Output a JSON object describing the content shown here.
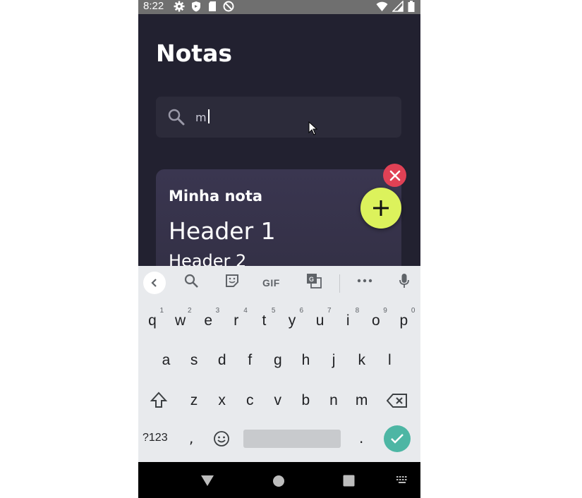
{
  "status_bar": {
    "time": "8:22"
  },
  "app": {
    "title": "Notas",
    "search": {
      "value": "m",
      "placeholder": ""
    },
    "note": {
      "title": "Minha nota",
      "header1": "Header 1",
      "header2": "Header 2"
    }
  },
  "keyboard": {
    "gif_label": "GIF",
    "row1": [
      {
        "key": "q",
        "hint": "1"
      },
      {
        "key": "w",
        "hint": "2"
      },
      {
        "key": "e",
        "hint": "3"
      },
      {
        "key": "r",
        "hint": "4"
      },
      {
        "key": "t",
        "hint": "5"
      },
      {
        "key": "y",
        "hint": "6"
      },
      {
        "key": "u",
        "hint": "7"
      },
      {
        "key": "i",
        "hint": "8"
      },
      {
        "key": "o",
        "hint": "9"
      },
      {
        "key": "p",
        "hint": "0"
      }
    ],
    "row2": [
      "a",
      "s",
      "d",
      "f",
      "g",
      "h",
      "j",
      "k",
      "l"
    ],
    "row3": [
      "z",
      "x",
      "c",
      "v",
      "b",
      "n",
      "m"
    ],
    "symbols_key": "?123",
    "comma_key": ",",
    "period_key": "."
  },
  "colors": {
    "accent": "#dcf25c",
    "delete": "#e04155",
    "enter": "#4db6a4",
    "background": "#201f2a"
  }
}
